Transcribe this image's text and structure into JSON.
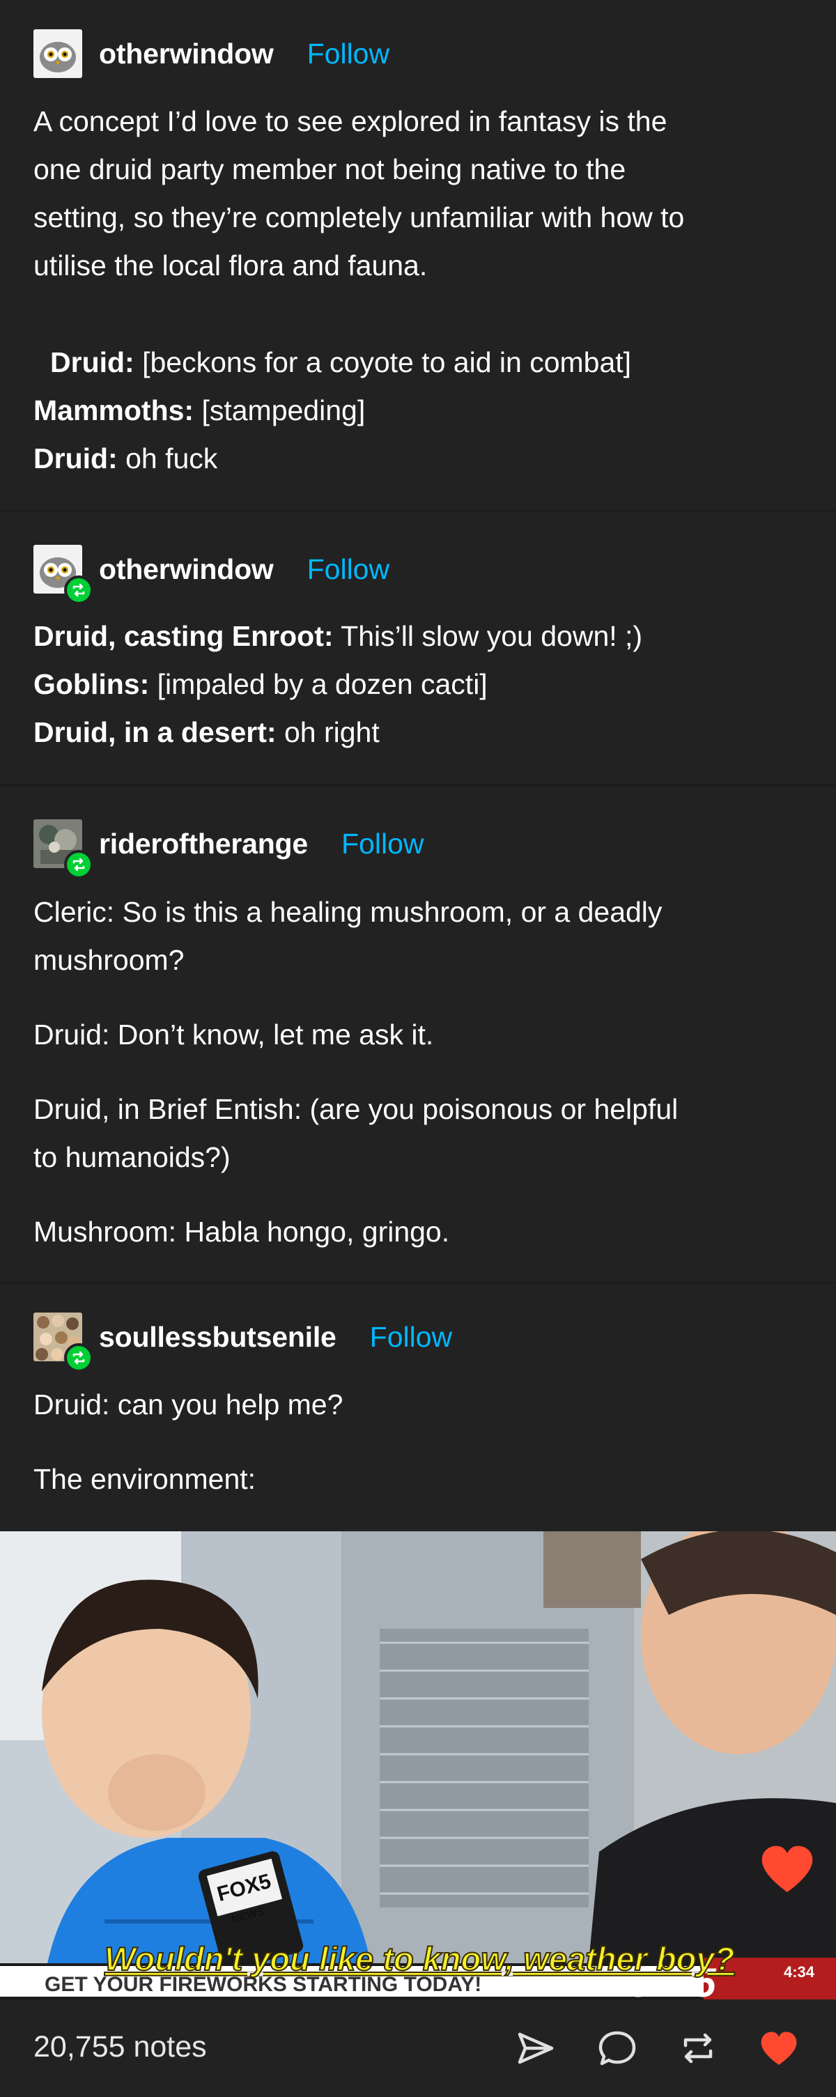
{
  "posts": [
    {
      "username": "otherwindow",
      "follow": "Follow",
      "lines": [
        "A concept I’d love to see explored in fantasy is the",
        "one druid party member not being native to the",
        "setting, so they’re completely unfamiliar with how to",
        "utilise the local flora and fauna."
      ],
      "dialogue": [
        {
          "speaker": "Druid:",
          "text": " [beckons for a coyote to aid in combat]"
        },
        {
          "speaker": "Mammoths:",
          "text": " [stampeding]"
        },
        {
          "speaker": "Druid:",
          "text": " oh fuck"
        }
      ]
    },
    {
      "username": "otherwindow",
      "follow": "Follow",
      "dialogue": [
        {
          "speaker": "Druid, casting Enroot:",
          "text": " This’ll slow you down! ;)"
        },
        {
          "speaker": "Goblins:",
          "text": " [impaled by a dozen cacti]"
        },
        {
          "speaker": "Druid, in a desert:",
          "text": " oh right"
        }
      ]
    },
    {
      "username": "rideroftherange",
      "follow": "Follow",
      "lines": [
        "Cleric: So is this a healing mushroom, or a deadly",
        "mushroom?",
        "Druid: Don’t know, let me ask it.",
        "Druid, in Brief Entish: (are you poisonous or helpful",
        "to humanoids?)",
        "Mushroom: Habla hongo, gringo."
      ]
    },
    {
      "username": "soullessbutsenile",
      "follow": "Follow",
      "lines": [
        "Druid: can you help me?",
        "The environment:"
      ]
    }
  ],
  "media": {
    "caption": "Wouldn't you like to know, weather boy?",
    "ticker": "GET YOUR FIREWORKS STARTING TODAY!",
    "channel": "FOX 5",
    "mic_label": "FOX5",
    "mic_sub": "NEWS",
    "time": "4:34"
  },
  "footer": {
    "notes": "20,755 notes"
  },
  "icons": {
    "share": "paper-plane-icon",
    "reply": "speech-bubble-icon",
    "reblog": "reblog-icon",
    "like": "heart-icon"
  },
  "colors": {
    "background": "#222222",
    "follow": "#00b8ff",
    "reblog_badge": "#00cf35",
    "heart": "#ff4930"
  }
}
